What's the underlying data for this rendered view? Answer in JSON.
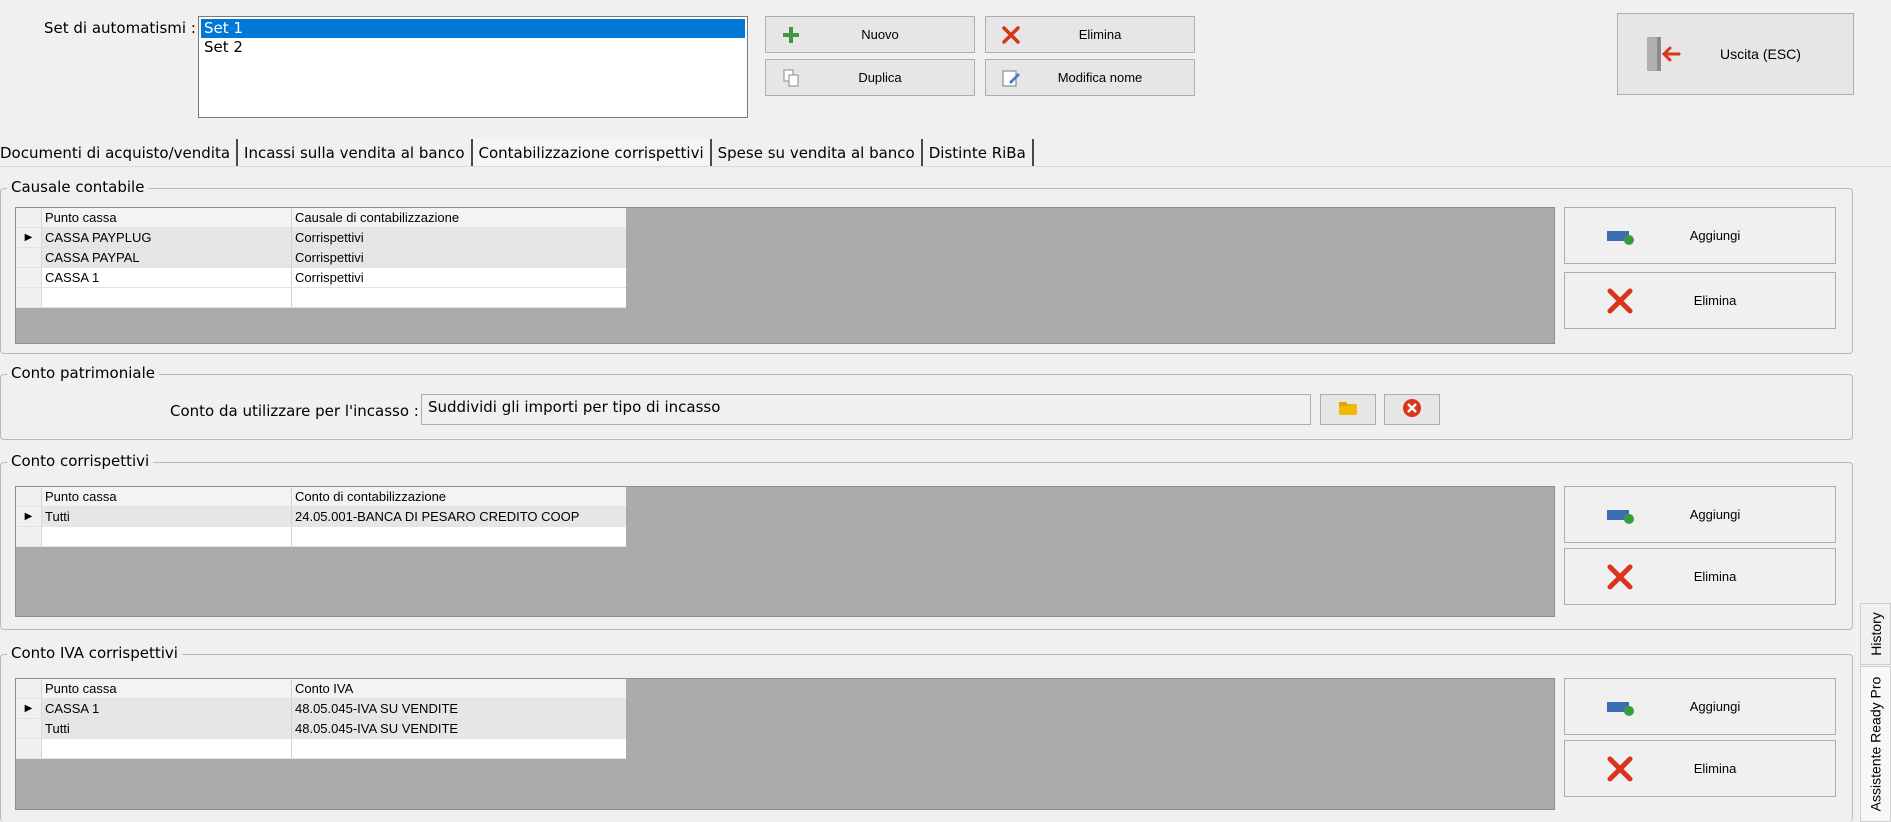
{
  "set": {
    "label": "Set di automatismi :",
    "items": [
      "Set 1",
      "Set 2"
    ],
    "selected_index": 0
  },
  "toolbar": {
    "new_label": "Nuovo",
    "delete_label": "Elimina",
    "duplicate_label": "Duplica",
    "rename_label": "Modifica nome",
    "exit_label": "Uscita (ESC)"
  },
  "tabs": [
    "Documenti di acquisto/vendita",
    "Incassi sulla vendita al banco",
    "Contabilizzazione corrispettivi",
    "Spese su vendita al banco",
    "Distinte RiBa"
  ],
  "active_tab_index": 2,
  "causale": {
    "title": "Causale contabile",
    "columns": [
      "Punto cassa",
      "Causale di contabilizzazione"
    ],
    "rows": [
      [
        "CASSA PAYPLUG",
        "Corrispettivi"
      ],
      [
        "CASSA PAYPAL",
        "Corrispettivi"
      ],
      [
        "CASSA 1",
        "Corrispettivi"
      ]
    ],
    "add_label": "Aggiungi",
    "delete_label": "Elimina"
  },
  "patrimoniale": {
    "title": "Conto patrimoniale",
    "field_label": "Conto da utilizzare per l'incasso :",
    "field_value": "Suddividi gli importi per tipo di incasso"
  },
  "corrispettivi": {
    "title": "Conto corrispettivi",
    "columns": [
      "Punto cassa",
      "Conto di contabilizzazione"
    ],
    "rows": [
      [
        "Tutti",
        "24.05.001-BANCA DI PESARO CREDITO COOP"
      ]
    ],
    "add_label": "Aggiungi",
    "delete_label": "Elimina"
  },
  "iva": {
    "title": "Conto IVA corrispettivi",
    "columns": [
      "Punto cassa",
      "Conto IVA"
    ],
    "rows": [
      [
        "CASSA 1",
        "48.05.045-IVA SU VENDITE"
      ],
      [
        "Tutti",
        "48.05.045-IVA SU VENDITE"
      ]
    ],
    "add_label": "Aggiungi",
    "delete_label": "Elimina"
  },
  "side_tabs": {
    "history": "History",
    "assistant": "Assistente Ready Pro"
  },
  "colors": {
    "selection": "#0078d7",
    "delete_red": "#d9341c",
    "add_green": "#3c9a3c",
    "grid_bg": "#ababab"
  }
}
